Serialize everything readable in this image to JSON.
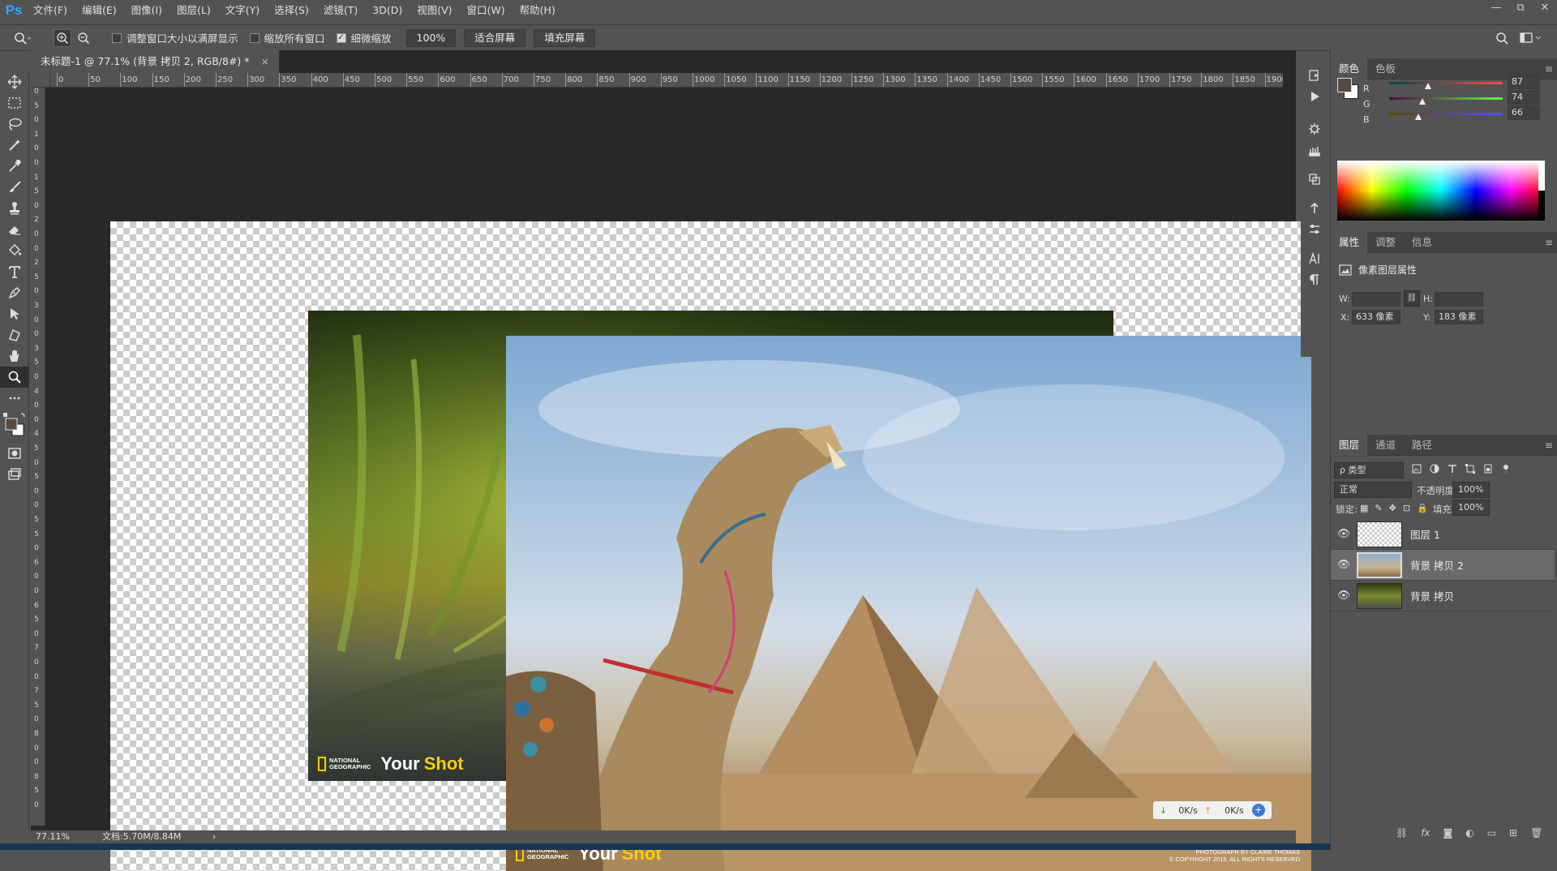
{
  "app": {
    "logo": "Ps"
  },
  "menu": [
    "文件(F)",
    "编辑(E)",
    "图像(I)",
    "图层(L)",
    "文字(Y)",
    "选择(S)",
    "滤镜(T)",
    "3D(D)",
    "视图(V)",
    "窗口(W)",
    "帮助(H)"
  ],
  "window_controls": {
    "minimize": "—",
    "restore": "⧉",
    "close": "✕"
  },
  "options": {
    "resize_windows": "调整窗口大小以满屏显示",
    "zoom_all": "缩放所有窗口",
    "scrubby_zoom": "细微缩放",
    "zoom_value": "100%",
    "fit_screen": "适合屏幕",
    "fill_screen": "填充屏幕"
  },
  "document": {
    "tab_title": "未标题-1 @ 77.1% (背景 拷贝 2, RGB/8#) *",
    "tab_close": "×",
    "zoom": "77.11%",
    "doc_info": "文档:5.70M/8.84M",
    "status_arrow": "›"
  },
  "ruler_h": [
    "0",
    "50",
    "100",
    "150",
    "200",
    "250",
    "300",
    "350",
    "400",
    "450",
    "500",
    "550",
    "600",
    "650",
    "700",
    "750",
    "800",
    "850",
    "900",
    "950",
    "1000",
    "1050",
    "1100",
    "1150",
    "1200",
    "1250",
    "1300",
    "1350",
    "1400",
    "1450",
    "1500",
    "1550",
    "1600",
    "1650",
    "1700",
    "1750",
    "1800",
    "1850",
    "1900"
  ],
  "ruler_v": [
    "0",
    "5",
    "0",
    "1",
    "0",
    "0",
    "1",
    "5",
    "0",
    "2",
    "0",
    "0",
    "2",
    "5",
    "0",
    "3",
    "0",
    "0",
    "3",
    "5",
    "0",
    "4",
    "0",
    "0",
    "4",
    "5",
    "0",
    "5",
    "0",
    "0",
    "5",
    "5",
    "0",
    "6",
    "0",
    "0",
    "6",
    "5",
    "0",
    "7",
    "0",
    "0",
    "7",
    "5",
    "0",
    "8",
    "0",
    "0",
    "8",
    "5",
    "0"
  ],
  "canvas_images": {
    "brand_line1": "NATIONAL",
    "brand_line2": "GEOGRAPHIC",
    "your": "Your",
    "shot": "Shot",
    "credit1": "PHOTOGRAPH BY CLAIRE THOMAS",
    "credit2": "© COPYRIGHT 2015. ALL RIGHTS RESERVED"
  },
  "netspeed": {
    "down": "0K/s",
    "up": "0K/s"
  },
  "color_panel": {
    "tabs": [
      "颜色",
      "色板"
    ],
    "r_label": "R",
    "g_label": "G",
    "b_label": "B",
    "r": "87",
    "g": "74",
    "b": "66",
    "r_level": 0.34,
    "g_level": 0.29,
    "b_level": 0.26,
    "foreground": "#574a42"
  },
  "properties_panel": {
    "tabs": [
      "属性",
      "调整",
      "信息"
    ],
    "title": "像素图层属性",
    "w_label": "W:",
    "h_label": "H:",
    "x_label": "X:",
    "x_value": "633 像素",
    "y_label": "Y:",
    "y_value": "183 像素"
  },
  "layers_panel": {
    "tabs": [
      "图层",
      "通道",
      "路径"
    ],
    "filter": "ρ 类型",
    "blend_mode": "正常",
    "opacity_label": "不透明度:",
    "opacity": "100%",
    "lock_label": "锁定:",
    "fill_label": "填充:",
    "fill": "100%",
    "layers": [
      {
        "name": "图层 1",
        "selected": false
      },
      {
        "name": "背景 拷贝 2",
        "selected": true
      },
      {
        "name": "背景 拷贝",
        "selected": false
      }
    ]
  },
  "colors": {
    "ps_blue": "#31a8ff",
    "ng_yellow": "#ffce00"
  }
}
